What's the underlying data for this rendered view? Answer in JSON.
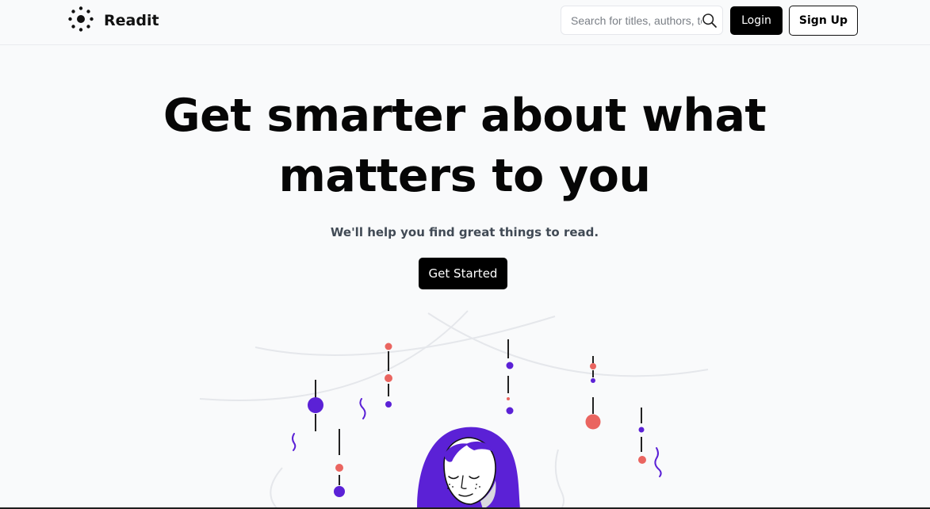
{
  "header": {
    "brand_name": "Readit",
    "search_placeholder": "Search for titles, authors, topics",
    "login_label": "Login",
    "signup_label": "Sign Up"
  },
  "hero": {
    "title": "Get smarter about what matters to you",
    "subtitle": "We'll help you find great things to read.",
    "cta_label": "Get Started"
  },
  "icons": {
    "brand": "sun-dots-logo-icon",
    "search": "search-icon"
  },
  "colors": {
    "page_background": "#f9fafb",
    "primary_button": "#000000",
    "illustration_purple": "#5b21d6",
    "illustration_coral": "#ea6560",
    "subtitle_text": "#414a55"
  }
}
